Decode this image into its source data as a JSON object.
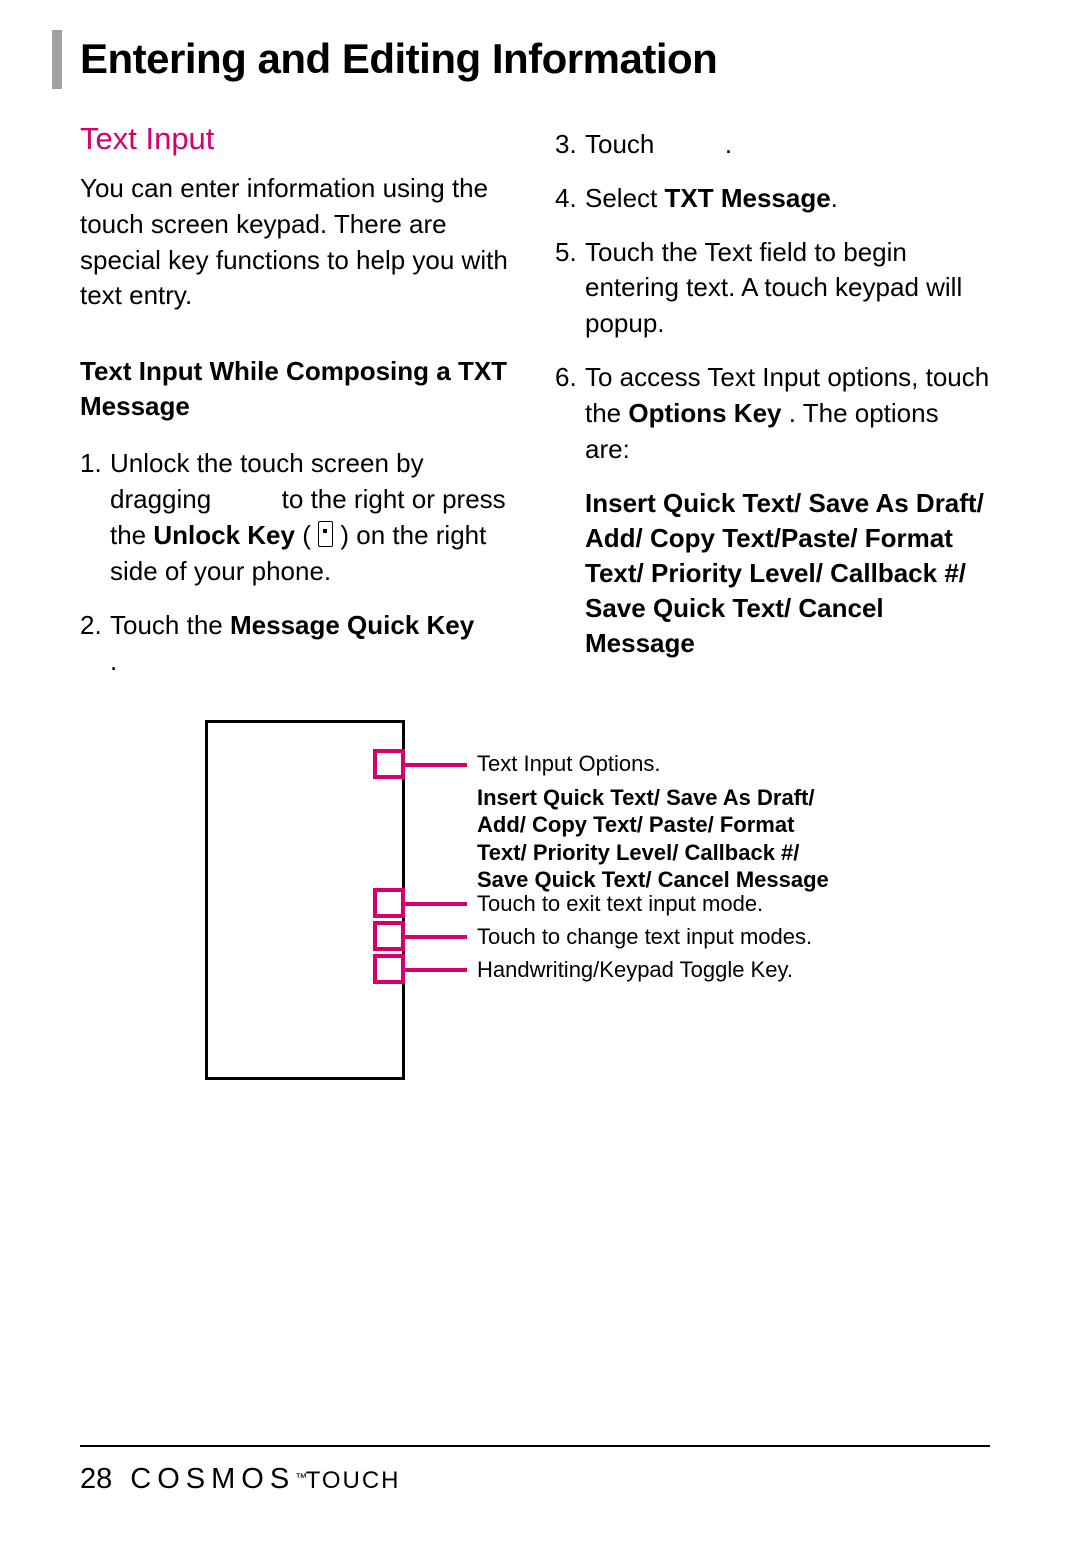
{
  "chapter_title": "Entering and Editing Information",
  "section_heading": "Text Input",
  "intro": "You can enter information using the touch screen keypad. There are special key functions to help you with text entry.",
  "subheading": "Text Input While Composing a TXT Message",
  "steps_left": {
    "s1_pre": "Unlock the touch screen by dragging ",
    "s1_mid": " to the right or press the ",
    "s1_unlock": "Unlock Key",
    "s1_post": " on the right side of your phone.",
    "s2_pre": "Touch the ",
    "s2_bold": "Message Quick Key",
    "s2_post": " ."
  },
  "steps_right": {
    "s3_pre": "Touch ",
    "s3_post": ".",
    "s4_pre": "Select ",
    "s4_bold": "TXT Message",
    "s4_post": ".",
    "s5": "Touch the Text field to begin entering text. A touch keypad will popup.",
    "s6_pre": "To access Text Input options, touch the ",
    "s6_bold": "Options Key",
    "s6_mid": " . The options are:"
  },
  "options": "Insert Quick Text/ Save As Draft/ Add/ Copy Text/Paste/ Format Text/ Priority Level/ Callback #/ Save Quick Text/ Cancel Message",
  "callouts": {
    "c1": "Text Input Options.",
    "c1b": "Insert Quick Text/ Save As Draft/ Add/ Copy Text/ Paste/ Format Text/ Priority Level/ Callback #/ Save Quick Text/ Cancel Message",
    "c2": "Touch to exit text input mode.",
    "c3": "Touch to change text input modes.",
    "c4": "Handwriting/Keypad Toggle Key."
  },
  "footer": {
    "page": "28",
    "brand1": "COSMOS",
    "tm": "™",
    "brand2": "TOUCH"
  }
}
